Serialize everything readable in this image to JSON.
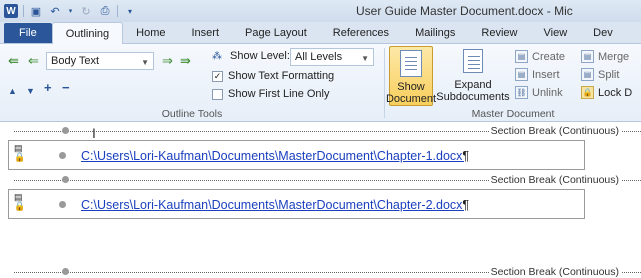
{
  "app": {
    "title": "User Guide Master Document.docx - Mic",
    "logo": "W"
  },
  "quick_access": {
    "save_icon": "save-icon",
    "undo_icon": "undo-icon",
    "redo_icon": "redo-icon",
    "print_icon": "print-icon",
    "customize_icon": "customize-qat-icon"
  },
  "tabs": [
    {
      "label": "File"
    },
    {
      "label": "Outlining"
    },
    {
      "label": "Home"
    },
    {
      "label": "Insert"
    },
    {
      "label": "Page Layout"
    },
    {
      "label": "References"
    },
    {
      "label": "Mailings"
    },
    {
      "label": "Review"
    },
    {
      "label": "View"
    },
    {
      "label": "Dev"
    }
  ],
  "outline_tools": {
    "group_label": "Outline Tools",
    "level_value": "Body Text",
    "show_level_label": "Show Level:",
    "show_level_value": "All Levels",
    "show_text_formatting": {
      "label": "Show Text Formatting",
      "checked": true
    },
    "show_first_line_only": {
      "label": "Show First Line Only",
      "checked": false
    }
  },
  "master_document": {
    "group_label": "Master Document",
    "show_document_label_1": "Show",
    "show_document_label_2": "Document",
    "expand_label_1": "Expand",
    "expand_label_2": "Subdocuments",
    "create_label": "Create",
    "insert_label": "Insert",
    "unlink_label": "Unlink",
    "merge_label": "Merge",
    "split_label": "Split",
    "lock_label": "Lock D"
  },
  "document": {
    "section_break_text": "Section Break (Continuous)",
    "subdocuments": [
      {
        "path": "C:\\Users\\Lori-Kaufman\\Documents\\MasterDocument\\Chapter-1.docx"
      },
      {
        "path": "C:\\Users\\Lori-Kaufman\\Documents\\MasterDocument\\Chapter-2.docx"
      }
    ],
    "pilcrow": "¶"
  },
  "colors": {
    "file_tab": "#2b579a",
    "active_button": "#f8cf5d",
    "link": "#1a3fbf"
  }
}
